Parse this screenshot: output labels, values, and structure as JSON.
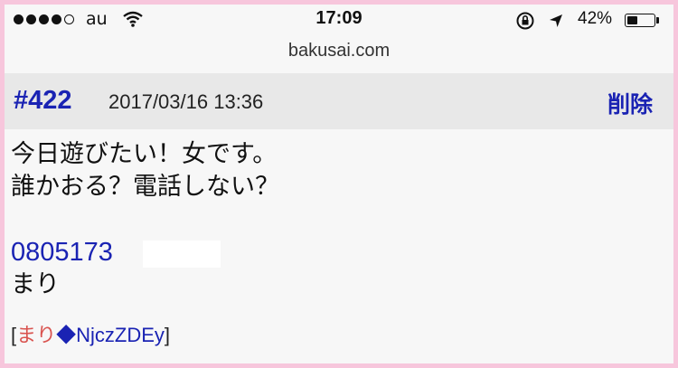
{
  "status_bar": {
    "carrier": "au",
    "time": "17:09",
    "battery_percent": "42%",
    "battery_level": 0.42,
    "signal_dots_filled": 4,
    "signal_dots_total": 5
  },
  "url_bar": {
    "domain": "bakusai.com"
  },
  "post": {
    "number": "#422",
    "date": "2017/03/16 13:36",
    "delete_label": "削除",
    "lines": [
      "今日遊びたい！女です。",
      "誰かおる？電話しない？"
    ],
    "phone": "0805173",
    "signoff": "まり",
    "author": {
      "open": "[",
      "name": "まり",
      "trip": "◆NjczZDEy",
      "close": "]"
    }
  },
  "colors": {
    "link": "#1a23b3",
    "author_name": "#d9534f",
    "frame_border": "#f7c6dc",
    "header_bg": "#e8e8e8"
  }
}
